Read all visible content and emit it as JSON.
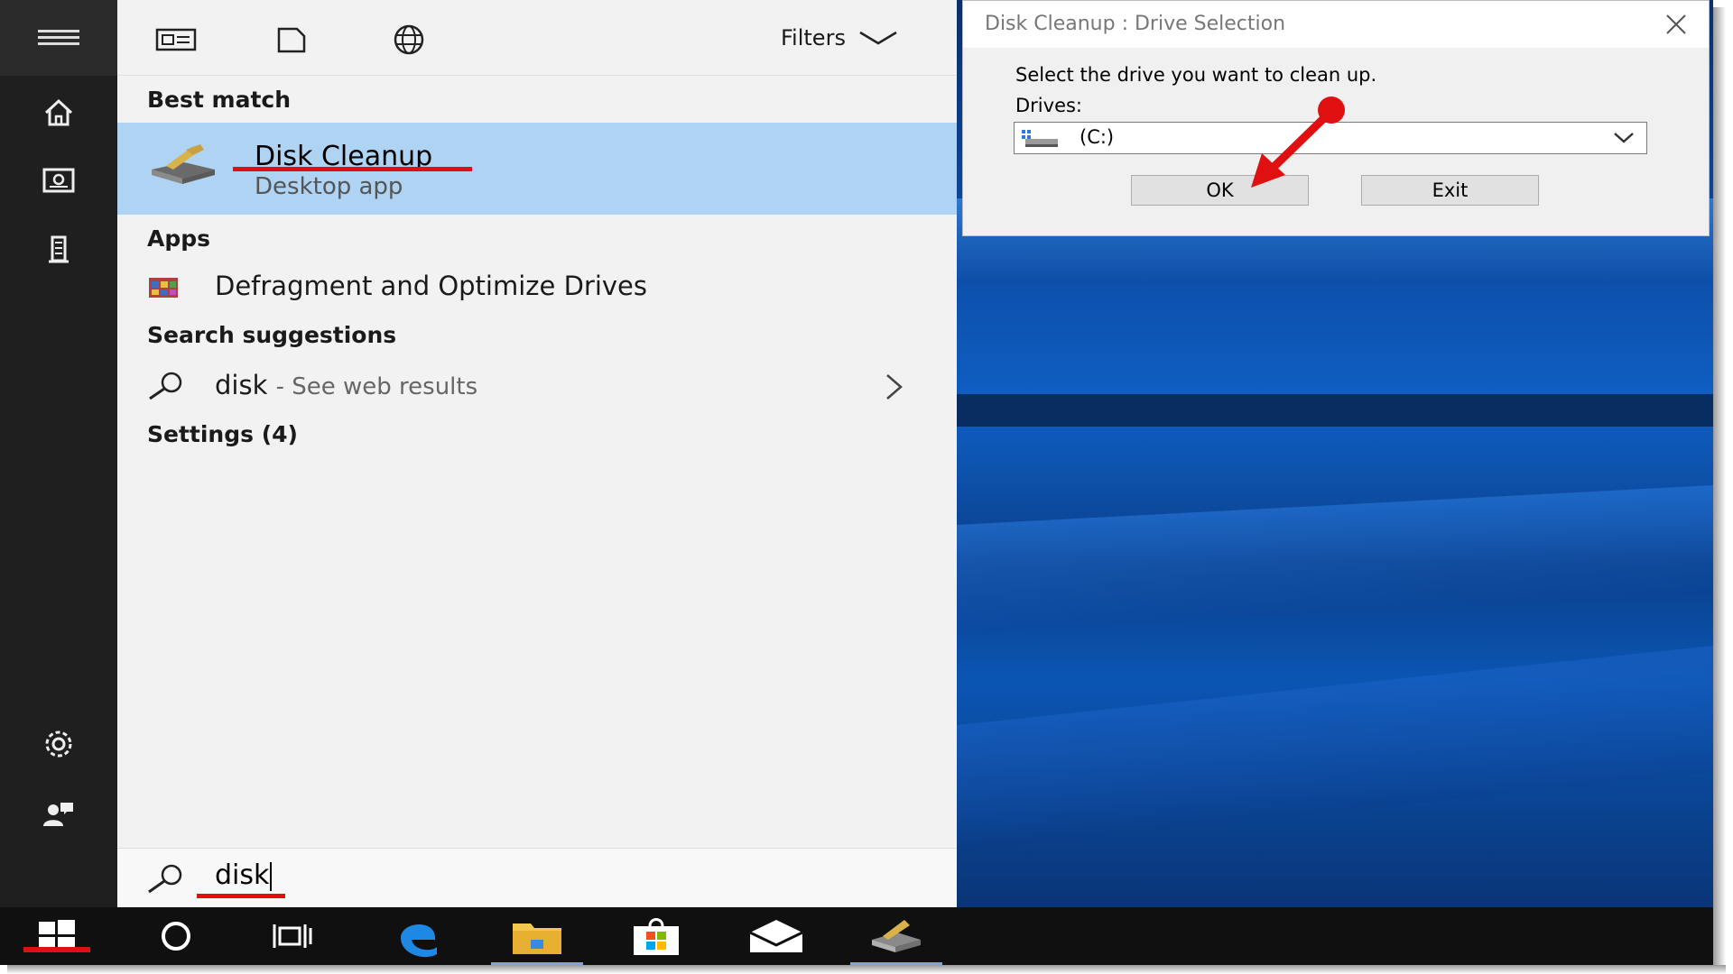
{
  "toolbar": {
    "filters_label": "Filters"
  },
  "sections": {
    "best_match": "Best match",
    "apps": "Apps",
    "search_suggestions": "Search suggestions",
    "settings": "Settings (4)"
  },
  "best_match": {
    "title": "Disk Cleanup",
    "subtitle": "Desktop app"
  },
  "apps": [
    {
      "label": "Defragment and Optimize Drives"
    }
  ],
  "suggestion": {
    "query": "disk",
    "suffix": "- See web results"
  },
  "search": {
    "value": "disk"
  },
  "dialog": {
    "title": "Disk Cleanup : Drive Selection",
    "prompt": "Select the drive you want to clean up.",
    "drives_label": "Drives:",
    "selected_drive": "(C:)",
    "ok_label": "OK",
    "exit_label": "Exit"
  },
  "rail_icons": [
    "menu-icon",
    "home-icon",
    "documents-icon",
    "building-icon",
    "gear-icon",
    "user-feedback-icon"
  ],
  "taskbar_icons": [
    "windows-start-icon",
    "cortana-circle-icon",
    "task-view-icon",
    "edge-icon",
    "file-explorer-icon",
    "store-icon",
    "mail-icon",
    "disk-cleanup-icon"
  ],
  "colors": {
    "highlight": "#aed3f3",
    "annotation_red": "#e01010",
    "rail": "#1f1f1f",
    "taskbar": "#101010"
  }
}
